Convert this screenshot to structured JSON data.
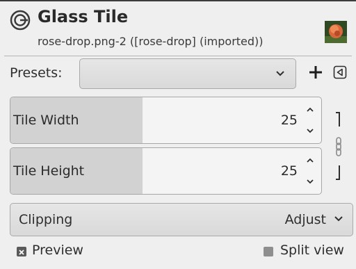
{
  "header": {
    "title": "Glass Tile",
    "subtitle": "rose-drop.png-2 ([rose-drop] (imported))",
    "app_icon": "gimp-icon",
    "thumbnail": "image-thumbnail"
  },
  "presets": {
    "label": "Presets:",
    "value": "",
    "add_icon": "plus-icon",
    "menu_icon": "triangle-menu-icon"
  },
  "params": [
    {
      "label": "Tile Width",
      "value": "25",
      "fraction": 0.42
    },
    {
      "label": "Tile Height",
      "value": "25",
      "fraction": 0.42
    }
  ],
  "chain": {
    "icon": "chain-link-icon",
    "linked": true
  },
  "clipping": {
    "label": "Clipping",
    "value": "Adjust"
  },
  "preview": {
    "label": "Preview",
    "checked": true
  },
  "split_view": {
    "label": "Split view",
    "checked": false
  },
  "colors": {
    "background": "#efefef",
    "fill": "#d2d2d2",
    "border": "#a7a7a7"
  }
}
